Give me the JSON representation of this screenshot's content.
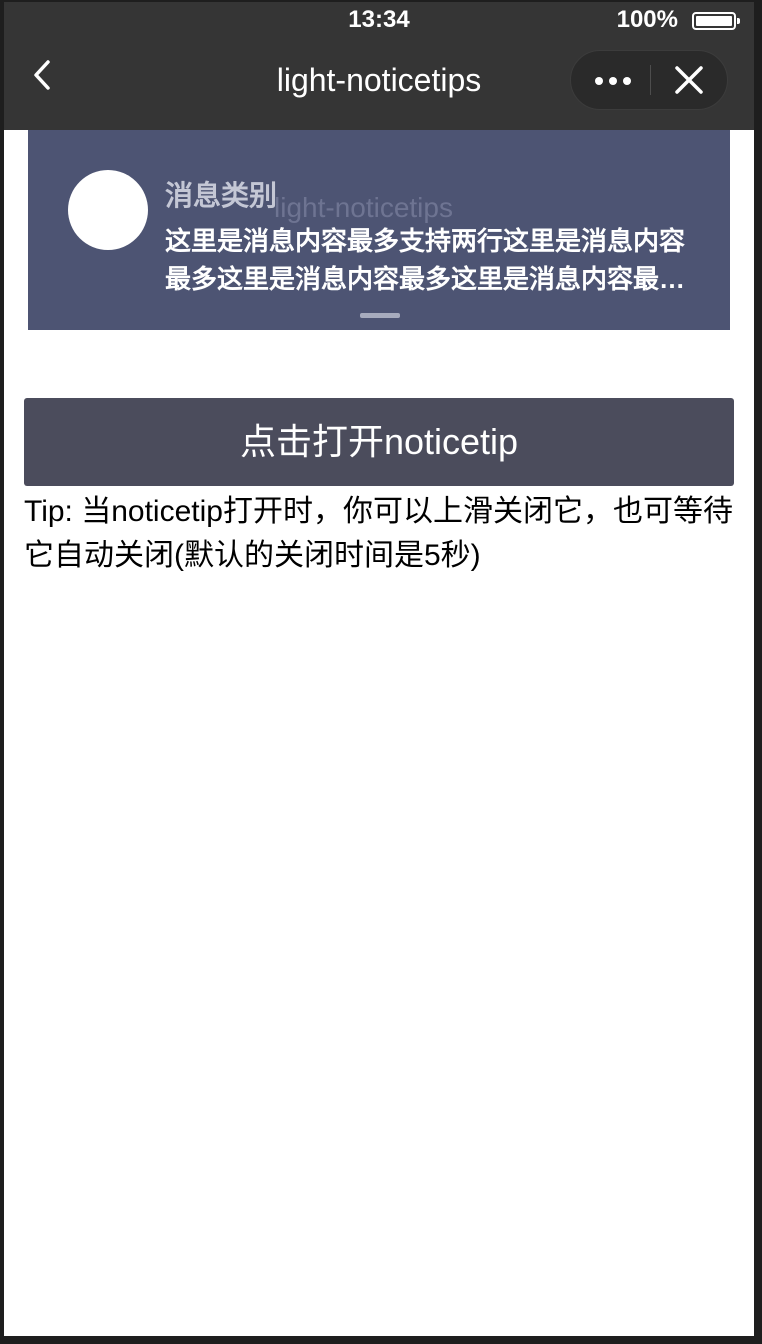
{
  "status_bar": {
    "time": "13:34",
    "battery_percent": "100%",
    "battery_level": 1.0
  },
  "nav_bar": {
    "title": "light-noticetips",
    "icons": [
      "back-icon",
      "more-icon",
      "close-icon"
    ]
  },
  "notice": {
    "category": "消息类别",
    "ghost_title": "light-noticetips",
    "content": "这里是消息内容最多支持两行这里是消息内容最多这里是消息内容最多这里是消息内容最多支持两行",
    "background_color": "#4d5473"
  },
  "main": {
    "open_button_label": "点击打开noticetip",
    "tip_text": "Tip: 当noticetip打开时，你可以上滑关闭它，也可等待它自动关闭(默认的关闭时间是5秒)"
  },
  "colors": {
    "nav_background": "#353535",
    "button_background": "#4b4c5c",
    "page_background": "#ffffff"
  }
}
